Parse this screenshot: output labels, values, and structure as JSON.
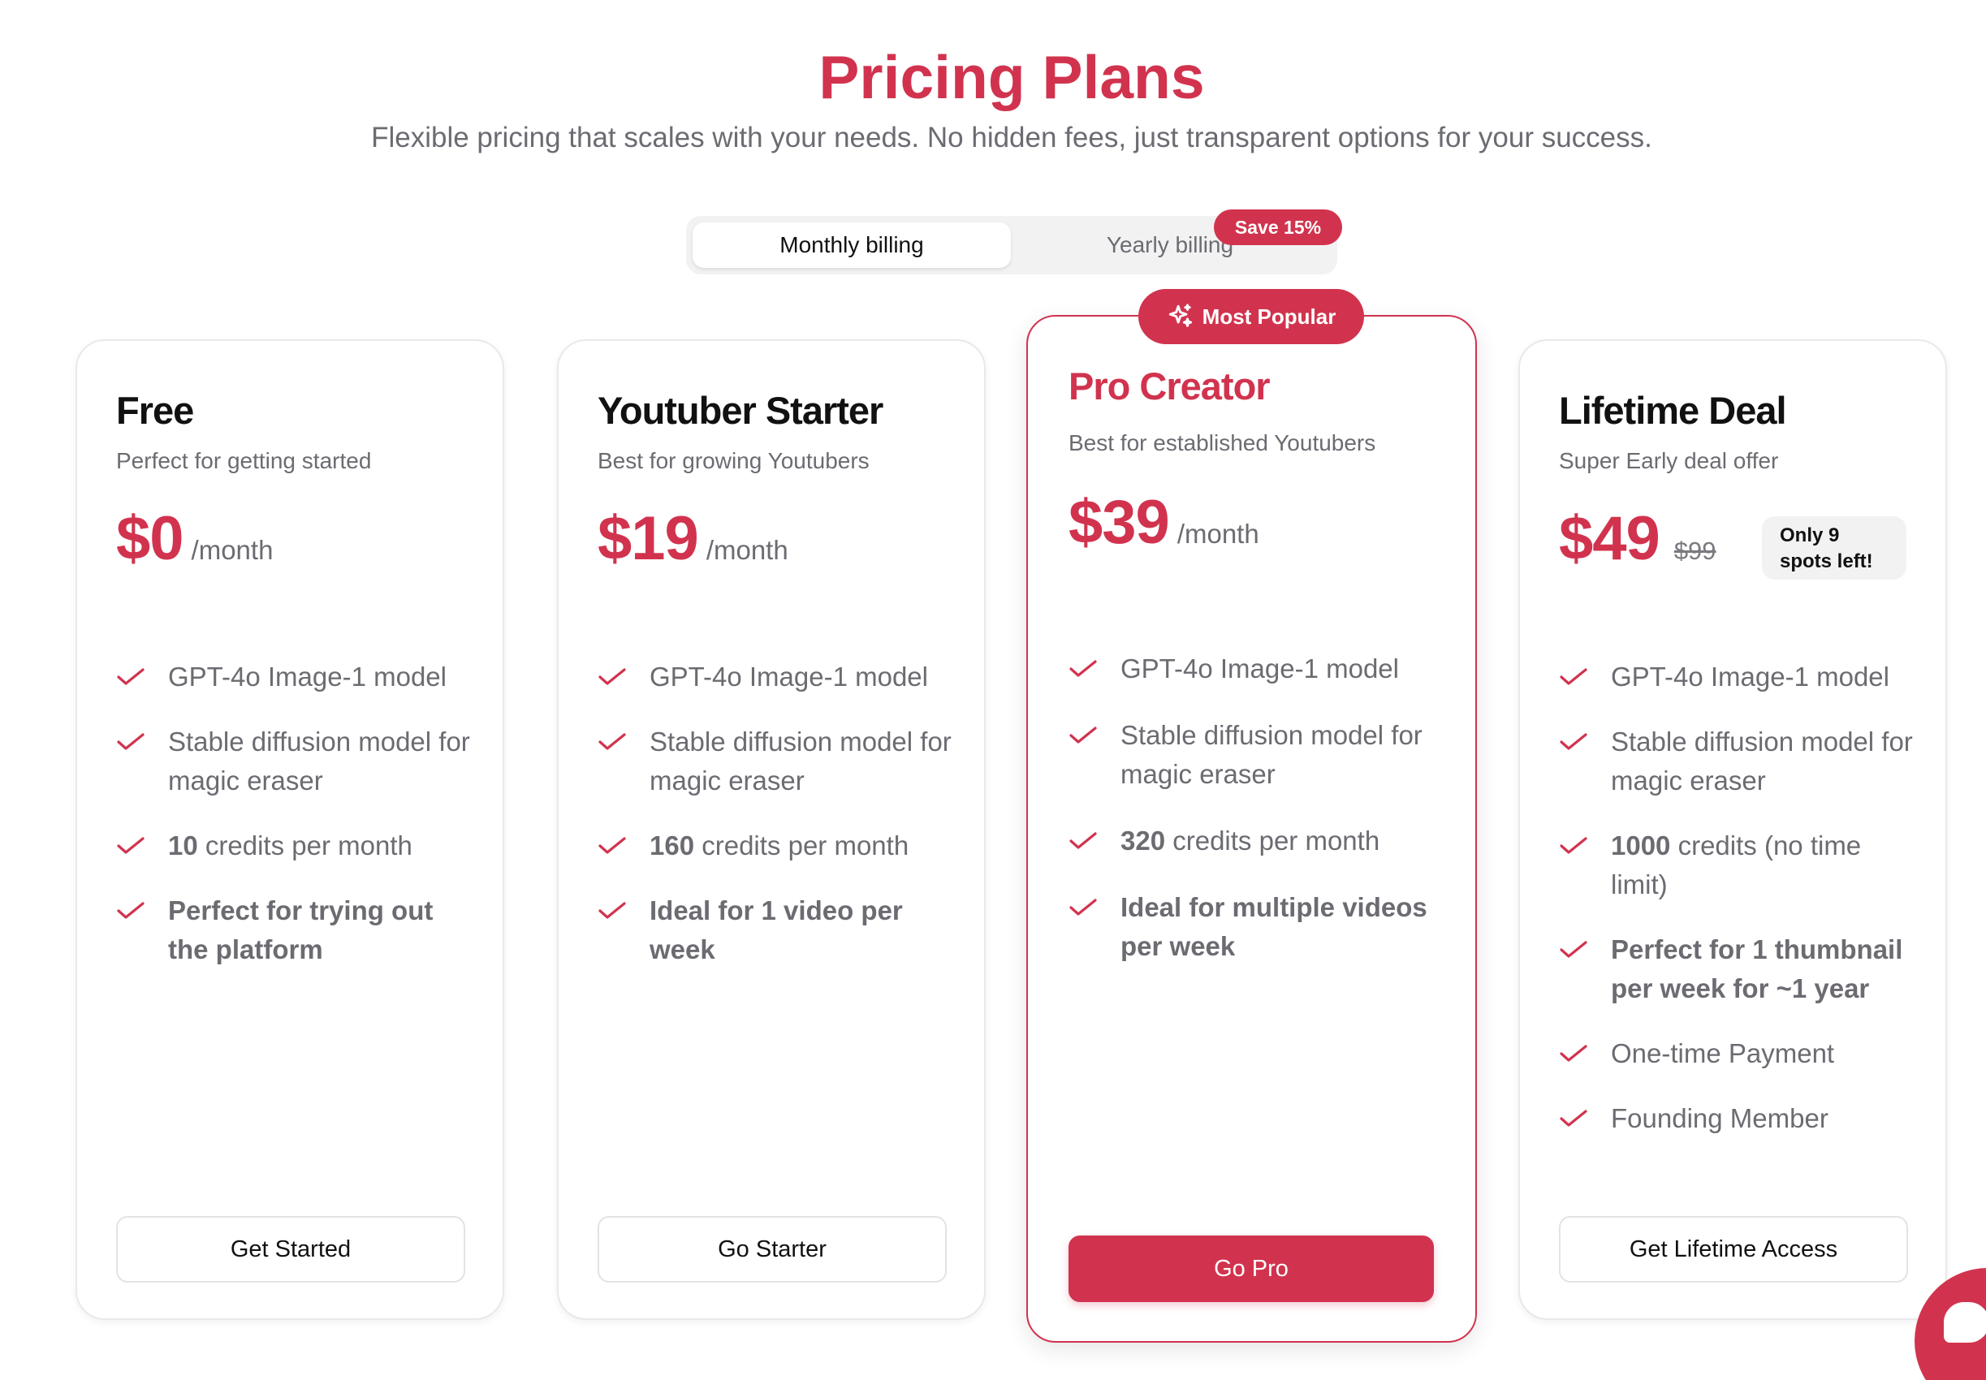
{
  "header": {
    "title": "Pricing Plans",
    "subtitle": "Flexible pricing that scales with your needs. No hidden fees, just transparent options for your success."
  },
  "billing_toggle": {
    "monthly_label": "Monthly billing",
    "yearly_label": "Yearly billing",
    "selected": "Monthly billing",
    "save_badge": "Save 15%"
  },
  "popular_badge": "Most Popular",
  "colors": {
    "accent": "#d1334e",
    "muted_text": "#6b6b72",
    "border": "#e9e9ec"
  },
  "plans": [
    {
      "name": "Free",
      "description": "Perfect for getting started",
      "price": "$0",
      "period": "/month",
      "features": [
        {
          "text": "GPT-4o Image-1 model"
        },
        {
          "text": "Stable diffusion model for magic eraser"
        },
        {
          "bold": "10",
          "text": " credits per month"
        },
        {
          "bold": "Perfect for trying out the platform"
        }
      ],
      "button": "Get Started"
    },
    {
      "name": "Youtuber Starter",
      "description": "Best for growing Youtubers",
      "price": "$19",
      "period": "/month",
      "features": [
        {
          "text": "GPT-4o Image-1 model"
        },
        {
          "text": "Stable diffusion model for magic eraser"
        },
        {
          "bold": "160",
          "text": " credits per month"
        },
        {
          "bold": "Ideal for 1 video per week"
        }
      ],
      "button": "Go Starter"
    },
    {
      "name": "Pro Creator",
      "description": "Best for established Youtubers",
      "price": "$39",
      "period": "/month",
      "features": [
        {
          "text": "GPT-4o Image-1 model"
        },
        {
          "text": "Stable diffusion model for magic eraser"
        },
        {
          "bold": "320",
          "text": " credits per month"
        },
        {
          "bold": "Ideal for multiple videos per week"
        }
      ],
      "button": "Go Pro"
    },
    {
      "name": "Lifetime Deal",
      "description": "Super Early deal offer",
      "price": "$49",
      "old_price": "$99",
      "spots_badge": "Only 9 spots left!",
      "features": [
        {
          "text": "GPT-4o Image-1 model"
        },
        {
          "text": "Stable diffusion model for magic eraser"
        },
        {
          "bold": "1000",
          "text": " credits (no time limit)"
        },
        {
          "bold": "Perfect for 1 thumbnail per week for ~1 year"
        },
        {
          "text": "One-time Payment"
        },
        {
          "text": "Founding Member"
        }
      ],
      "button": "Get Lifetime Access"
    }
  ]
}
